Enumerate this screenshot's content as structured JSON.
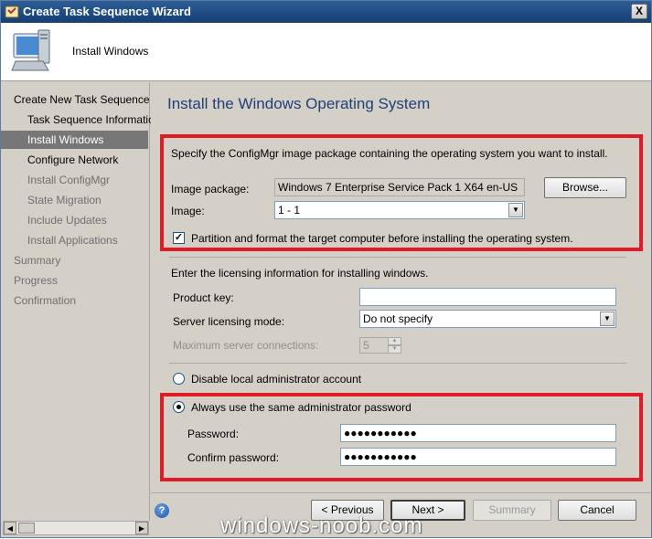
{
  "window": {
    "title": "Create Task Sequence Wizard",
    "close_glyph": "X"
  },
  "header": {
    "title": "Install Windows"
  },
  "sidebar": {
    "items": [
      {
        "label": "Create New Task Sequence",
        "state": "done"
      },
      {
        "label": "Task Sequence Information",
        "state": "done"
      },
      {
        "label": "Install Windows",
        "state": "active"
      },
      {
        "label": "Configure Network",
        "state": "done"
      },
      {
        "label": "Install ConfigMgr",
        "state": "pending"
      },
      {
        "label": "State Migration",
        "state": "pending"
      },
      {
        "label": "Include Updates",
        "state": "pending"
      },
      {
        "label": "Install Applications",
        "state": "pending"
      },
      {
        "label": "Summary",
        "state": "pending"
      },
      {
        "label": "Progress",
        "state": "pending"
      },
      {
        "label": "Confirmation",
        "state": "pending"
      }
    ]
  },
  "page": {
    "title": "Install the Windows Operating System",
    "image_section": {
      "instruction": "Specify the ConfigMgr image package containing the operating system you want to install.",
      "image_package_label": "Image package:",
      "image_package_value": "Windows 7 Enterprise Service Pack 1 X64 en-US",
      "browse_label": "Browse...",
      "image_label": "Image:",
      "image_value": "1 - 1",
      "partition_label": "Partition and format the target computer before installing the operating system.",
      "partition_checked": true
    },
    "licensing": {
      "instruction": "Enter the licensing information for installing windows.",
      "product_key_label": "Product key:",
      "product_key_value": "",
      "server_mode_label": "Server licensing mode:",
      "server_mode_value": "Do not specify",
      "max_connections_label": "Maximum server connections:",
      "max_connections_value": "5"
    },
    "admin": {
      "disable_label": "Disable local administrator account",
      "always_label": "Always use the same administrator password",
      "selected": "always",
      "password_label": "Password:",
      "password_value": "●●●●●●●●●●●",
      "confirm_label": "Confirm password:",
      "confirm_value": "●●●●●●●●●●●"
    }
  },
  "buttons": {
    "previous": "< Previous",
    "next": "Next >",
    "summary": "Summary",
    "cancel": "Cancel",
    "help_glyph": "?"
  },
  "watermark": "windows-noob.com",
  "colors": {
    "highlight": "#e01b24",
    "title_blue": "#1f3f79",
    "active_nav": "#777777"
  }
}
